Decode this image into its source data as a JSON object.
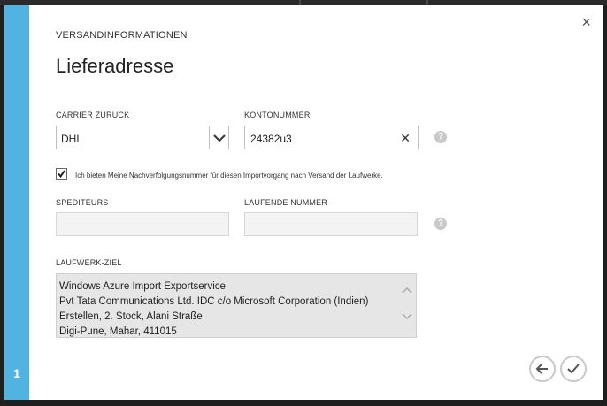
{
  "dialog": {
    "section_label": "VERSANDINFORMATIONEN",
    "heading": "Lieferadresse",
    "close_glyph": "×"
  },
  "carrier": {
    "label": "CARRIER ZURÜCK",
    "selected": "DHL"
  },
  "account": {
    "label": "KONTONUMMER",
    "value": "24382u3"
  },
  "tracking_opt_in": {
    "checked": true,
    "text": "Ich bieten Meine Nachverfolgungsnummer für diesen Importvorgang nach Versand der Laufwerke."
  },
  "forwarder": {
    "label": "SPEDITEURS",
    "value": ""
  },
  "running_number": {
    "label": "LAUFENDE NUMMER",
    "value": ""
  },
  "drive_destination": {
    "label": "LAUFWERK-ZIEL",
    "lines": [
      "Windows Azure Import Exportservice",
      "Pvt Tata Communications Ltd. IDC c/o Microsoft Corporation (Indien)",
      "Erstellen, 2. Stock, Alani Straße",
      "Digi-Pune, Mahar, 411015"
    ]
  },
  "wizard": {
    "step": "1"
  },
  "help_glyph": "?",
  "colors": {
    "accent": "#51b3e1",
    "background": "#3c3c3c"
  },
  "icons": [
    "close-icon",
    "chevron-down-icon",
    "clear-icon",
    "help-icon",
    "checkmark-icon",
    "back-arrow-icon",
    "confirm-check-icon"
  ]
}
